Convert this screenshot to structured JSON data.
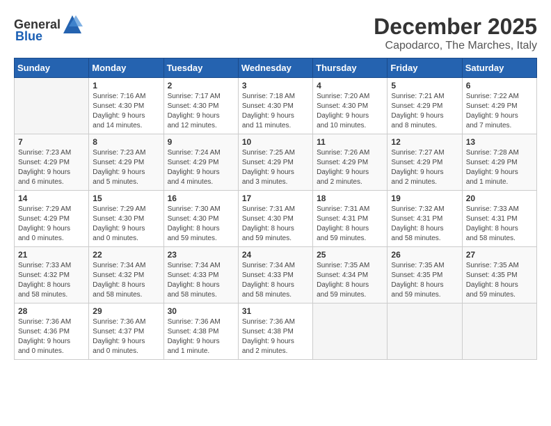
{
  "logo": {
    "general": "General",
    "blue": "Blue"
  },
  "header": {
    "month": "December 2025",
    "location": "Capodarco, The Marches, Italy"
  },
  "weekdays": [
    "Sunday",
    "Monday",
    "Tuesday",
    "Wednesday",
    "Thursday",
    "Friday",
    "Saturday"
  ],
  "weeks": [
    [
      {
        "day": "",
        "info": ""
      },
      {
        "day": "1",
        "info": "Sunrise: 7:16 AM\nSunset: 4:30 PM\nDaylight: 9 hours\nand 14 minutes."
      },
      {
        "day": "2",
        "info": "Sunrise: 7:17 AM\nSunset: 4:30 PM\nDaylight: 9 hours\nand 12 minutes."
      },
      {
        "day": "3",
        "info": "Sunrise: 7:18 AM\nSunset: 4:30 PM\nDaylight: 9 hours\nand 11 minutes."
      },
      {
        "day": "4",
        "info": "Sunrise: 7:20 AM\nSunset: 4:30 PM\nDaylight: 9 hours\nand 10 minutes."
      },
      {
        "day": "5",
        "info": "Sunrise: 7:21 AM\nSunset: 4:29 PM\nDaylight: 9 hours\nand 8 minutes."
      },
      {
        "day": "6",
        "info": "Sunrise: 7:22 AM\nSunset: 4:29 PM\nDaylight: 9 hours\nand 7 minutes."
      }
    ],
    [
      {
        "day": "7",
        "info": "Sunrise: 7:23 AM\nSunset: 4:29 PM\nDaylight: 9 hours\nand 6 minutes."
      },
      {
        "day": "8",
        "info": "Sunrise: 7:23 AM\nSunset: 4:29 PM\nDaylight: 9 hours\nand 5 minutes."
      },
      {
        "day": "9",
        "info": "Sunrise: 7:24 AM\nSunset: 4:29 PM\nDaylight: 9 hours\nand 4 minutes."
      },
      {
        "day": "10",
        "info": "Sunrise: 7:25 AM\nSunset: 4:29 PM\nDaylight: 9 hours\nand 3 minutes."
      },
      {
        "day": "11",
        "info": "Sunrise: 7:26 AM\nSunset: 4:29 PM\nDaylight: 9 hours\nand 2 minutes."
      },
      {
        "day": "12",
        "info": "Sunrise: 7:27 AM\nSunset: 4:29 PM\nDaylight: 9 hours\nand 2 minutes."
      },
      {
        "day": "13",
        "info": "Sunrise: 7:28 AM\nSunset: 4:29 PM\nDaylight: 9 hours\nand 1 minute."
      }
    ],
    [
      {
        "day": "14",
        "info": "Sunrise: 7:29 AM\nSunset: 4:29 PM\nDaylight: 9 hours\nand 0 minutes."
      },
      {
        "day": "15",
        "info": "Sunrise: 7:29 AM\nSunset: 4:30 PM\nDaylight: 9 hours\nand 0 minutes."
      },
      {
        "day": "16",
        "info": "Sunrise: 7:30 AM\nSunset: 4:30 PM\nDaylight: 8 hours\nand 59 minutes."
      },
      {
        "day": "17",
        "info": "Sunrise: 7:31 AM\nSunset: 4:30 PM\nDaylight: 8 hours\nand 59 minutes."
      },
      {
        "day": "18",
        "info": "Sunrise: 7:31 AM\nSunset: 4:31 PM\nDaylight: 8 hours\nand 59 minutes."
      },
      {
        "day": "19",
        "info": "Sunrise: 7:32 AM\nSunset: 4:31 PM\nDaylight: 8 hours\nand 58 minutes."
      },
      {
        "day": "20",
        "info": "Sunrise: 7:33 AM\nSunset: 4:31 PM\nDaylight: 8 hours\nand 58 minutes."
      }
    ],
    [
      {
        "day": "21",
        "info": "Sunrise: 7:33 AM\nSunset: 4:32 PM\nDaylight: 8 hours\nand 58 minutes."
      },
      {
        "day": "22",
        "info": "Sunrise: 7:34 AM\nSunset: 4:32 PM\nDaylight: 8 hours\nand 58 minutes."
      },
      {
        "day": "23",
        "info": "Sunrise: 7:34 AM\nSunset: 4:33 PM\nDaylight: 8 hours\nand 58 minutes."
      },
      {
        "day": "24",
        "info": "Sunrise: 7:34 AM\nSunset: 4:33 PM\nDaylight: 8 hours\nand 58 minutes."
      },
      {
        "day": "25",
        "info": "Sunrise: 7:35 AM\nSunset: 4:34 PM\nDaylight: 8 hours\nand 59 minutes."
      },
      {
        "day": "26",
        "info": "Sunrise: 7:35 AM\nSunset: 4:35 PM\nDaylight: 8 hours\nand 59 minutes."
      },
      {
        "day": "27",
        "info": "Sunrise: 7:35 AM\nSunset: 4:35 PM\nDaylight: 8 hours\nand 59 minutes."
      }
    ],
    [
      {
        "day": "28",
        "info": "Sunrise: 7:36 AM\nSunset: 4:36 PM\nDaylight: 9 hours\nand 0 minutes."
      },
      {
        "day": "29",
        "info": "Sunrise: 7:36 AM\nSunset: 4:37 PM\nDaylight: 9 hours\nand 0 minutes."
      },
      {
        "day": "30",
        "info": "Sunrise: 7:36 AM\nSunset: 4:38 PM\nDaylight: 9 hours\nand 1 minute."
      },
      {
        "day": "31",
        "info": "Sunrise: 7:36 AM\nSunset: 4:38 PM\nDaylight: 9 hours\nand 2 minutes."
      },
      {
        "day": "",
        "info": ""
      },
      {
        "day": "",
        "info": ""
      },
      {
        "day": "",
        "info": ""
      }
    ]
  ]
}
